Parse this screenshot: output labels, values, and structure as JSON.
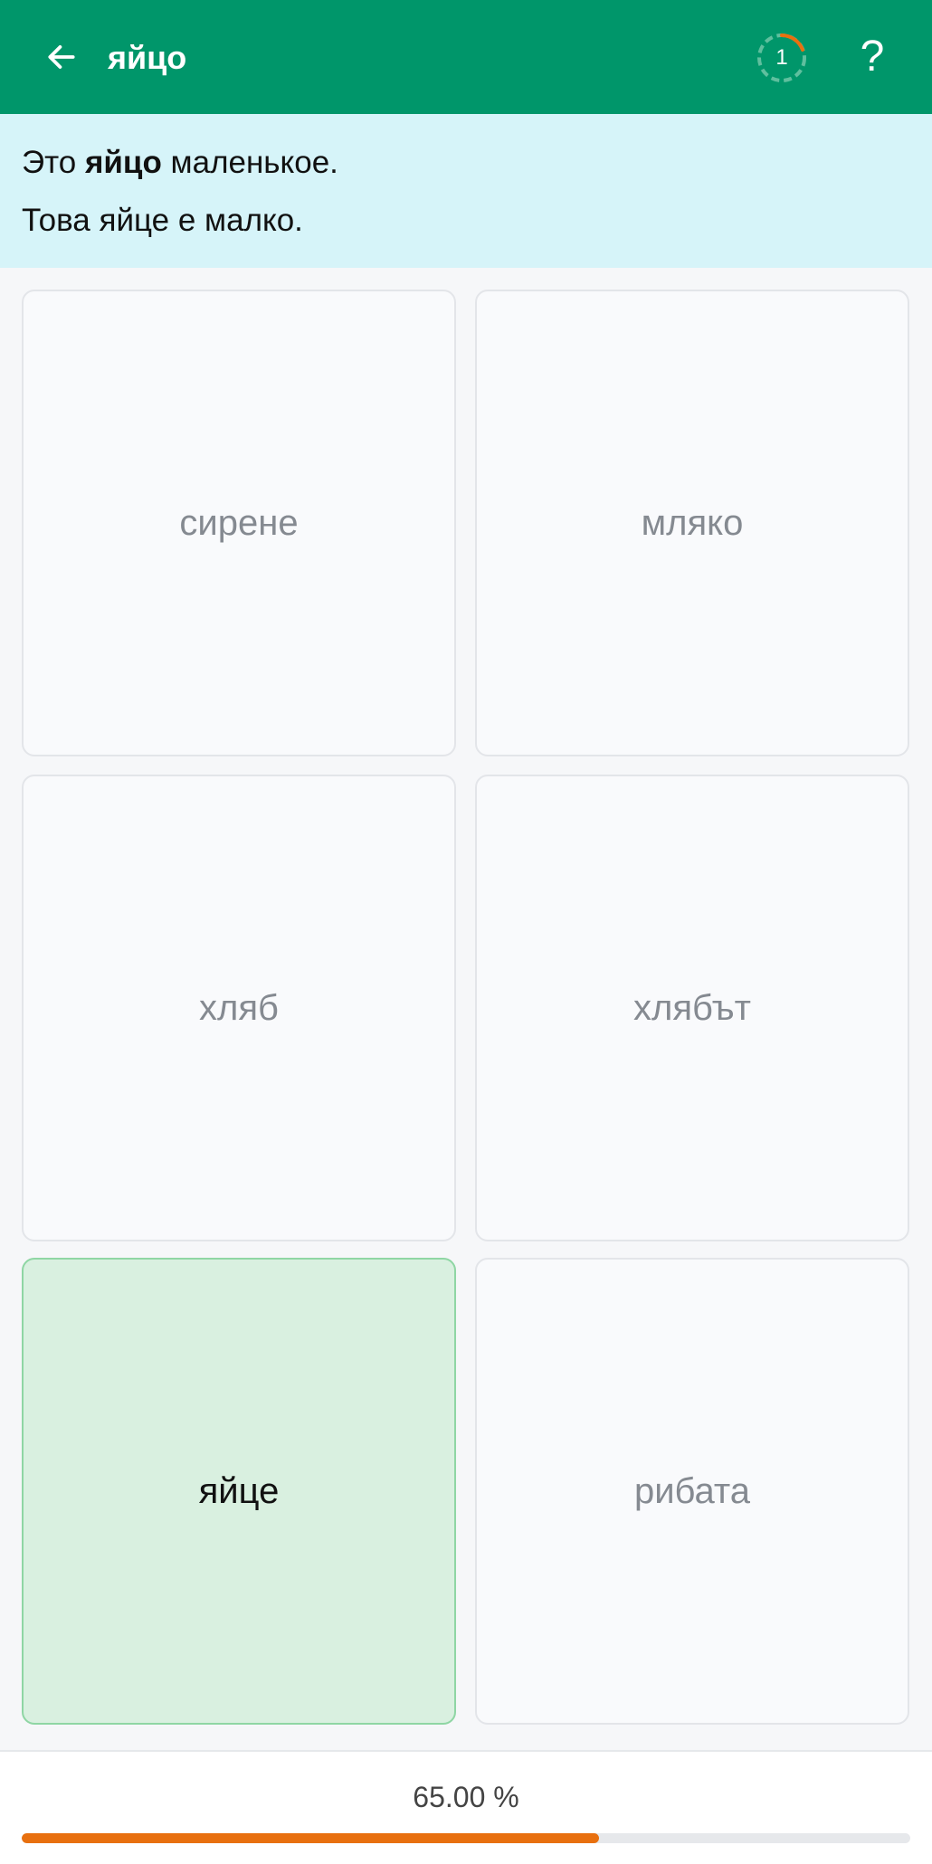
{
  "header": {
    "title": "яйцо",
    "back_icon": "arrow-left-icon",
    "review_count": "1",
    "help_label": "?",
    "ring_color": "#e8700f",
    "bar_color": "#00966a"
  },
  "sentence": {
    "ru_before": "Это ",
    "ru_bold": "яйцо",
    "ru_after": " маленькое.",
    "bg": "Това яйце е малко."
  },
  "options": [
    {
      "label": "сирене",
      "selected": false
    },
    {
      "label": "мляко",
      "selected": false
    },
    {
      "label": "хляб",
      "selected": false
    },
    {
      "label": "хлябът",
      "selected": false
    },
    {
      "label": "яйце",
      "selected": true
    },
    {
      "label": "рибата",
      "selected": false
    }
  ],
  "progress": {
    "text": "65.00 %",
    "value": 0.65,
    "color": "#e8700f"
  }
}
